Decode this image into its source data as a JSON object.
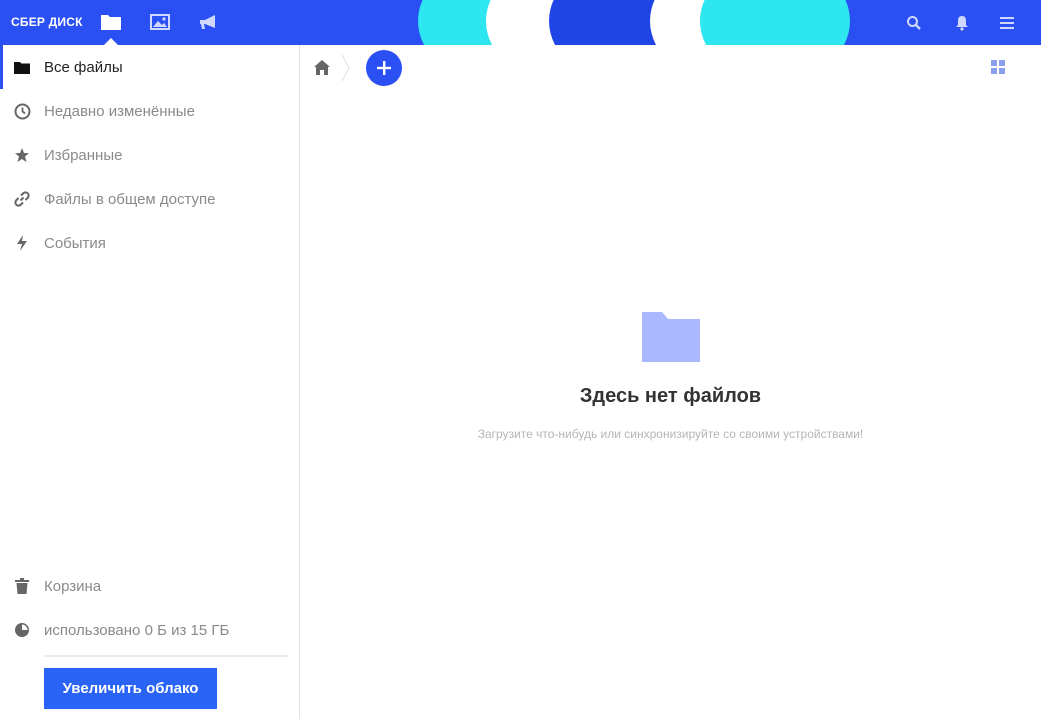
{
  "header": {
    "logo": "СБЕР ДИСК",
    "nav": [
      "folder-icon",
      "image-icon",
      "megaphone-icon"
    ],
    "actions": [
      "search-icon",
      "bell-icon",
      "menu-icon"
    ],
    "colors": {
      "primary": "#2a4ff2",
      "accent_cyan": "#2de6f0",
      "button": "#2a64f6"
    }
  },
  "sidebar": {
    "items": [
      {
        "label": "Все файлы",
        "icon": "folder-icon",
        "active": true
      },
      {
        "label": "Недавно изменённые",
        "icon": "clock-icon"
      },
      {
        "label": "Избранные",
        "icon": "star-icon"
      },
      {
        "label": "Файлы в общем доступе",
        "icon": "link-icon"
      },
      {
        "label": "События",
        "icon": "lightning-icon"
      }
    ],
    "trash": {
      "label": "Корзина",
      "icon": "trash-icon"
    },
    "usage": {
      "label": "использовано 0 Б из 15 ГБ",
      "icon": "pie-icon",
      "used_fraction": 0
    },
    "upgrade_button": "Увеличить облако"
  },
  "main": {
    "breadcrumb": {
      "home_icon": "home-icon"
    },
    "empty": {
      "title": "Здесь нет файлов",
      "subtitle": "Загрузите что-нибудь или синхронизируйте со своими устройствами!"
    }
  }
}
